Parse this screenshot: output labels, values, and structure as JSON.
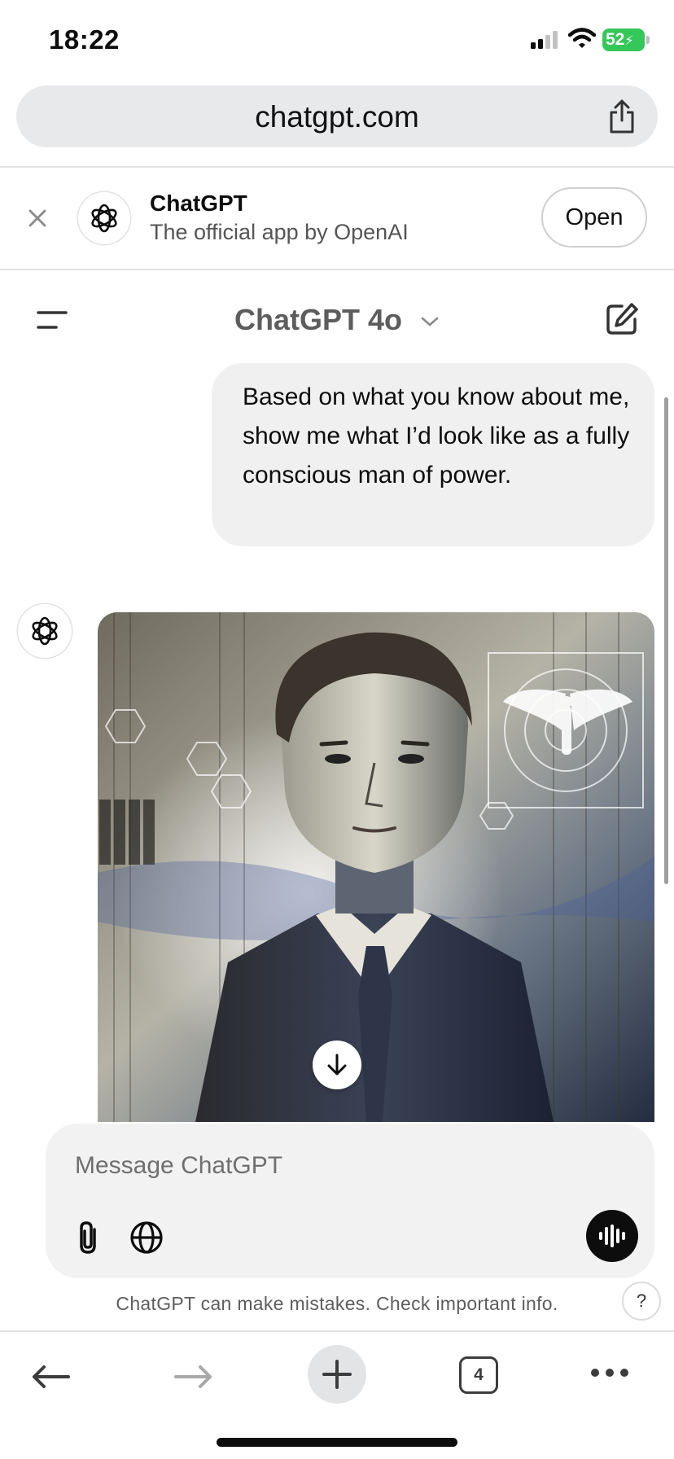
{
  "status_bar": {
    "time": "18:22",
    "battery": "52"
  },
  "browser": {
    "url": "chatgpt.com",
    "open_tabs": "4"
  },
  "app_banner": {
    "name": "ChatGPT",
    "subtitle": "The official app by OpenAI",
    "open_label": "Open"
  },
  "chat": {
    "model_title": "ChatGPT 4o",
    "user_message": "Based on what you know about me, show me what I’d look like as a fully conscious man of power."
  },
  "composer": {
    "placeholder": "Message ChatGPT"
  },
  "footer": {
    "disclaimer": "ChatGPT can make mistakes. Check important info.",
    "help_label": "?"
  },
  "icons": {
    "close": "close-icon",
    "share": "share-icon",
    "openai_logo": "openai-logo-icon",
    "menu": "menu-icon",
    "chevron": "chevron-down-icon",
    "edit": "new-chat-icon",
    "arrow_down": "arrow-down-icon",
    "attach": "paperclip-icon",
    "globe": "globe-icon",
    "voice": "voice-waveform-icon",
    "back": "back-arrow-icon",
    "forward": "forward-arrow-icon",
    "plus": "plus-icon",
    "more": "more-dots-icon"
  },
  "colors": {
    "battery_green": "#34c759",
    "bubble_bg": "#f0f0f0",
    "composer_bg": "#f2f2f2",
    "url_bar_bg": "#e8e9eb"
  }
}
